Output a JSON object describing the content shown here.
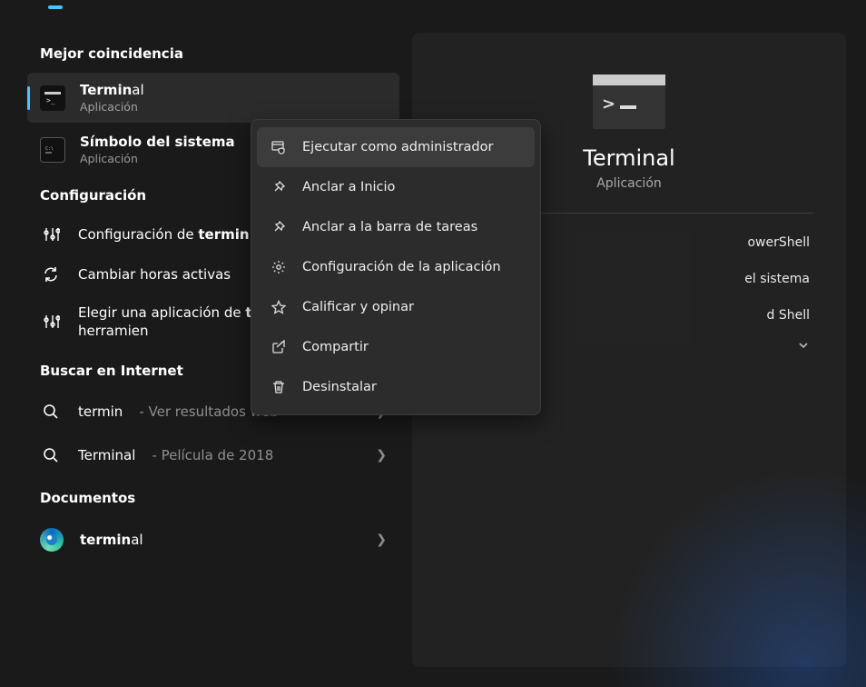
{
  "sections": {
    "best_match": "Mejor coincidencia",
    "settings": "Configuración",
    "web": "Buscar en Internet",
    "documents": "Documentos"
  },
  "best": {
    "items": [
      {
        "title_bold": "Termin",
        "title_rest": "al",
        "subtitle": "Aplicación"
      },
      {
        "title_bold": "Símbolo del sistema",
        "title_rest": "",
        "subtitle": "Aplicación"
      }
    ]
  },
  "settings_items": [
    {
      "pre": "Configuración de ",
      "bold": "termin",
      "post": ""
    },
    {
      "pre": "",
      "bold": "Cambiar horas activas",
      "post": ""
    },
    {
      "pre": "Elegir una aplicación de ",
      "bold": "termin",
      "post": "al para herramien"
    }
  ],
  "web_items": [
    {
      "query": "termin",
      "suffix": " - Ver resultados web"
    },
    {
      "query": "Terminal",
      "suffix": " - Película de 2018"
    }
  ],
  "doc_items": [
    {
      "bold": "termin",
      "rest": "al"
    }
  ],
  "right": {
    "title": "Terminal",
    "subtitle": "Aplicación",
    "related": [
      "owerShell",
      "el sistema",
      "d Shell"
    ]
  },
  "context_menu": [
    "Ejecutar como administrador",
    "Anclar a Inicio",
    "Anclar a la barra de tareas",
    "Configuración de la aplicación",
    "Calificar y opinar",
    "Compartir",
    "Desinstalar"
  ]
}
